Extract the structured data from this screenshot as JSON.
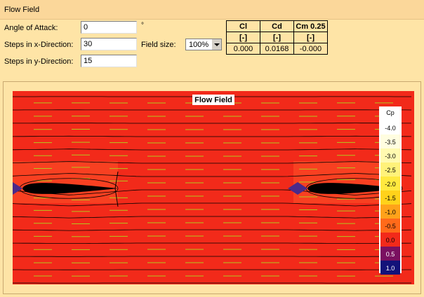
{
  "window": {
    "title": "Flow Field"
  },
  "form": {
    "angle_label": "Angle of Attack:",
    "angle_value": "0",
    "angle_unit": "°",
    "stepsx_label": "Steps in x-Direction:",
    "stepsx_value": "30",
    "stepsy_label": "Steps in y-Direction:",
    "stepsy_value": "15",
    "fieldsize_label": "Field size:",
    "fieldsize_value": "100%"
  },
  "coefficients": {
    "headers": [
      "Cl",
      "Cd",
      "Cm 0.25"
    ],
    "units": [
      "[-]",
      "[-]",
      "[-]"
    ],
    "values": [
      "0.000",
      "0.0168",
      "-0.000"
    ]
  },
  "plot": {
    "title": "Flow Field",
    "legend_title": "Cp",
    "legend": [
      {
        "label": "-4.0",
        "color": "#ffffff"
      },
      {
        "label": "-3.5",
        "color": "#fffde0"
      },
      {
        "label": "-3.0",
        "color": "#fffab0"
      },
      {
        "label": "-2.5",
        "color": "#fff27a"
      },
      {
        "label": "-2.0",
        "color": "#ffe93f"
      },
      {
        "label": "-1.5",
        "color": "#ffd21a"
      },
      {
        "label": "-1.0",
        "color": "#ffa21a"
      },
      {
        "label": "-0.5",
        "color": "#ff6a1a"
      },
      {
        "label": "0.0",
        "color": "#f22a1a"
      },
      {
        "label": "0.5",
        "color": "#7a1060"
      },
      {
        "label": "1.0",
        "color": "#13127a"
      }
    ],
    "colors": {
      "field": "#f22a1a",
      "streamline": "#000000",
      "vector": "#b4c81e",
      "airfoil": "#000000",
      "stagnation": "#4a2a8a"
    }
  }
}
